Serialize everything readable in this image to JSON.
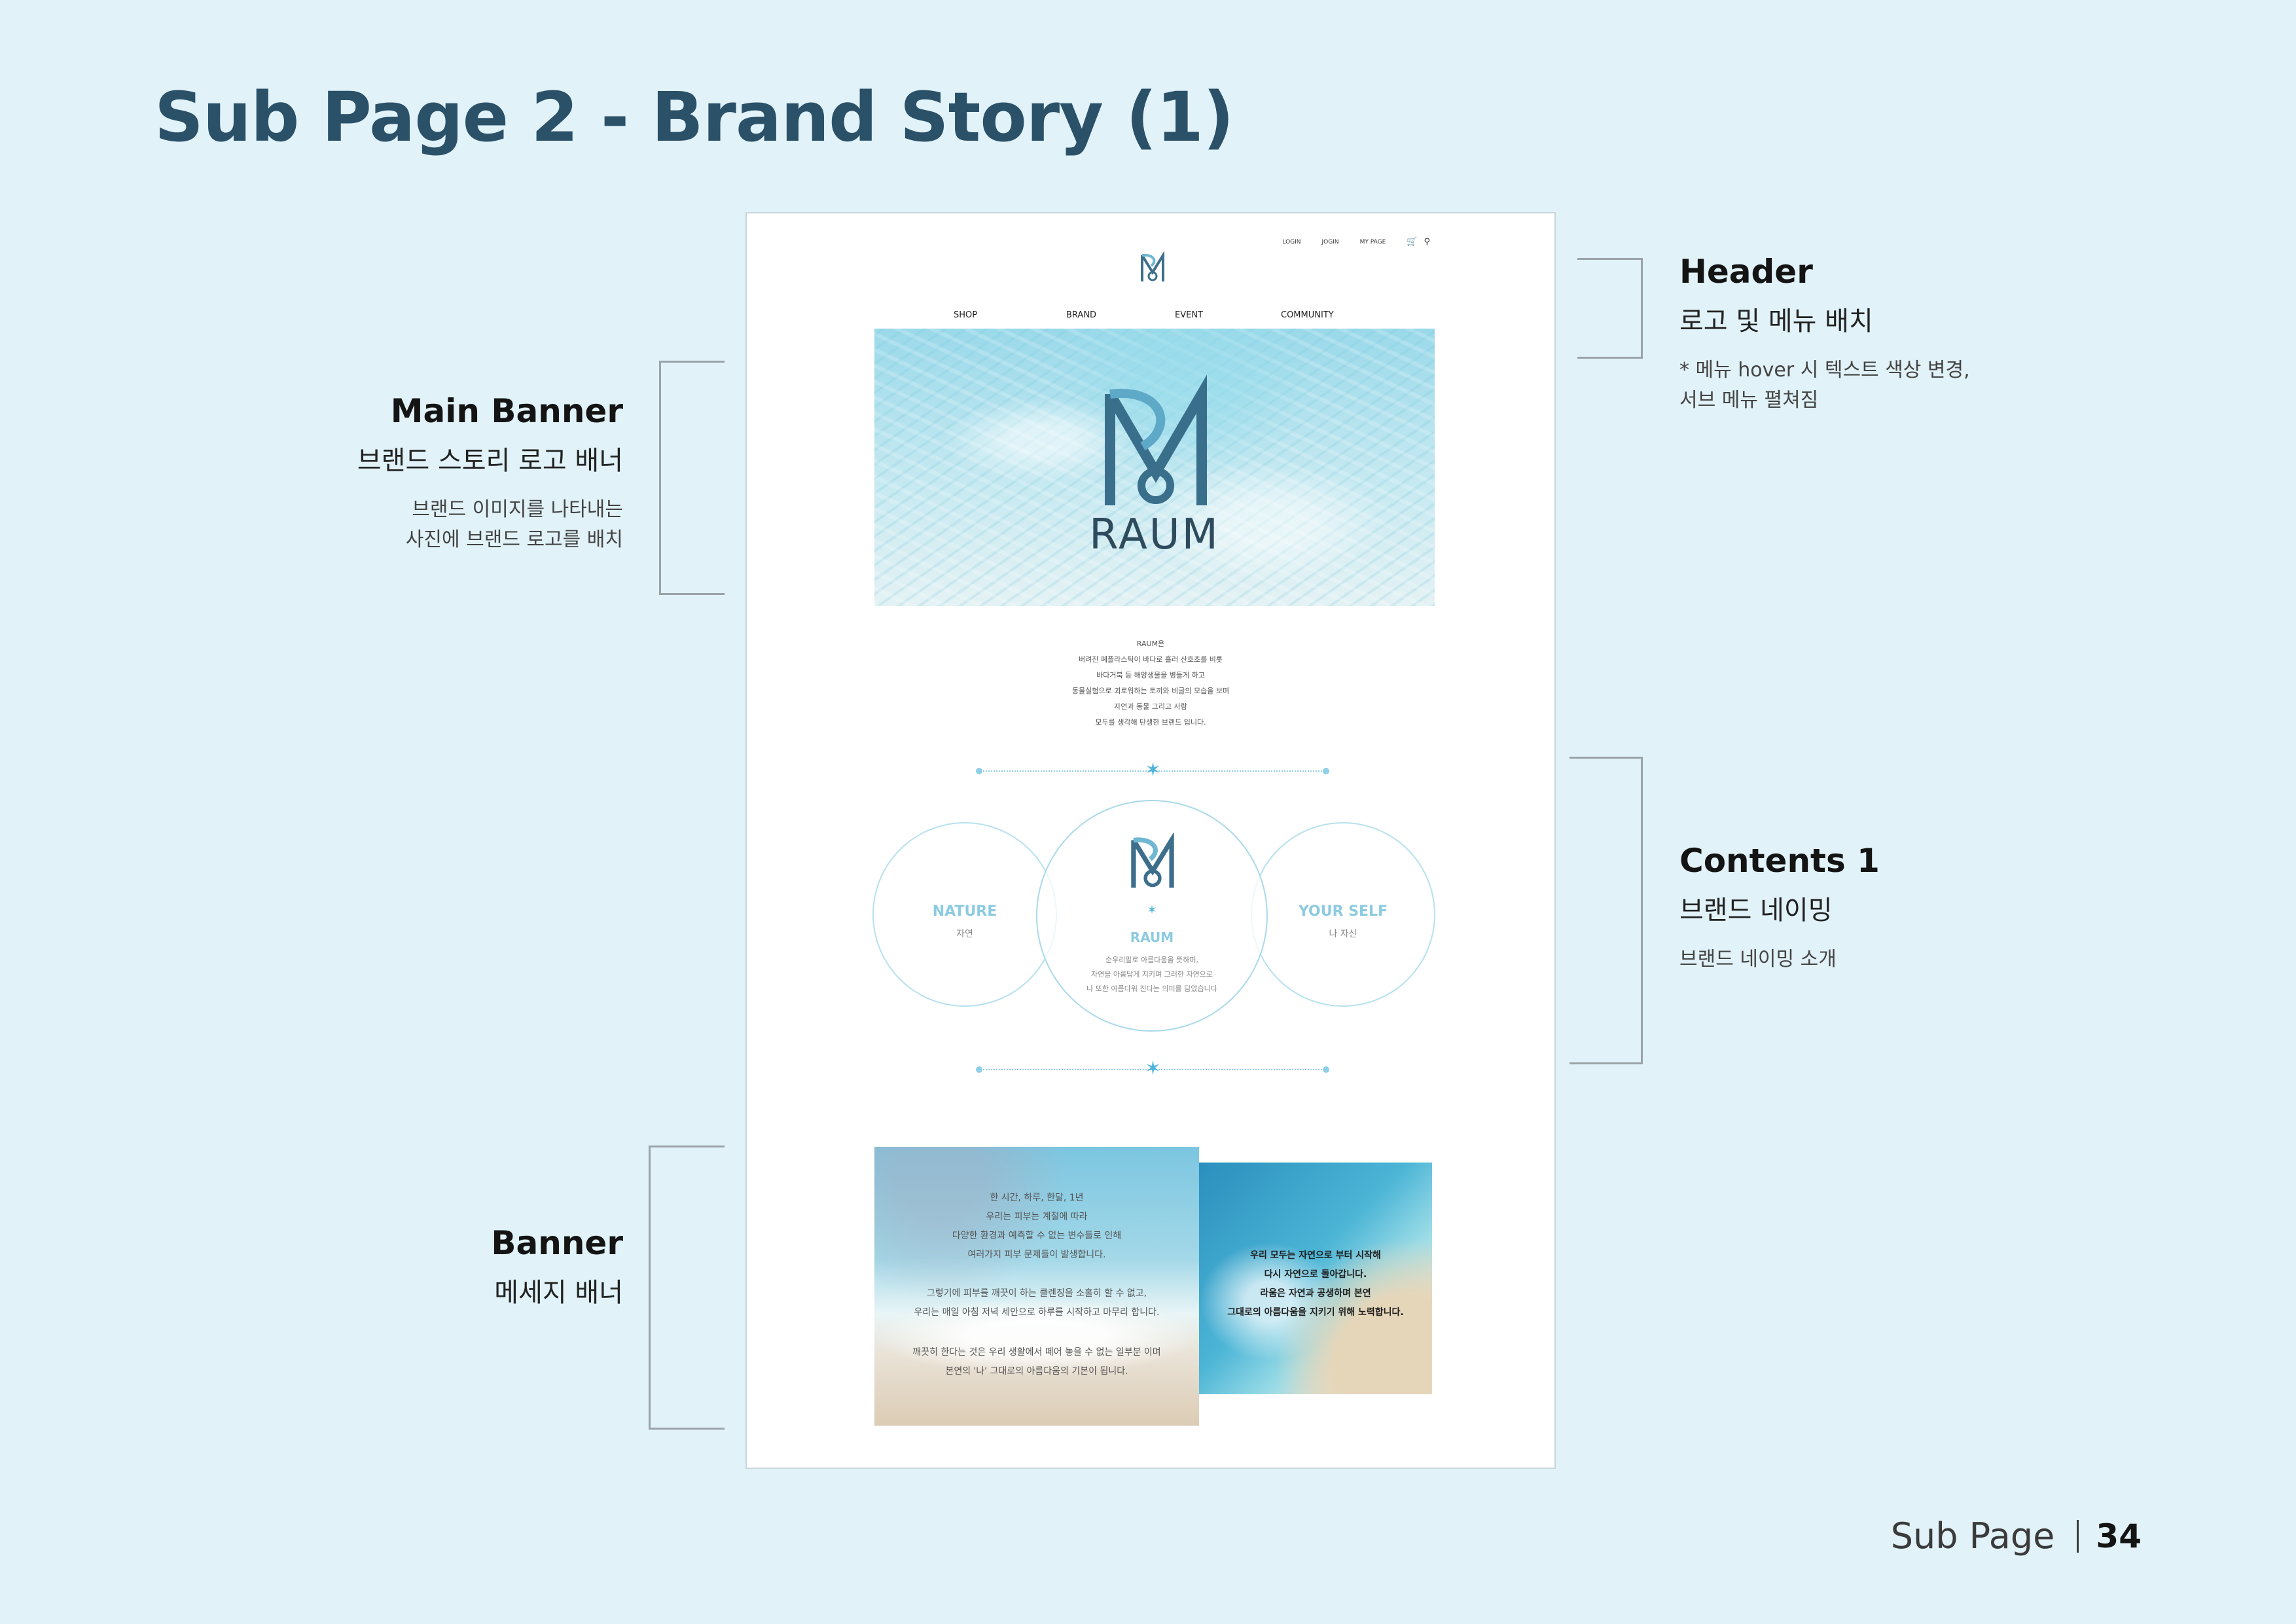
{
  "slide": {
    "title": "Sub Page 2 - Brand Story (1)"
  },
  "annotations": {
    "header": {
      "title": "Header",
      "subtitle": "로고 및 메뉴 배치",
      "desc": "* 메뉴 hover 시 텍스트 색상 변경,\n서브 메뉴 펼쳐짐"
    },
    "main_banner": {
      "title": "Main Banner",
      "subtitle": "브랜드 스토리 로고 배너",
      "desc": "브랜드 이미지를 나타내는\n사진에 브랜드 로고를 배치"
    },
    "contents1": {
      "title": "Contents 1",
      "subtitle": "브랜드 네이밍",
      "desc": "브랜드 네이밍 소개"
    },
    "banner": {
      "title": "Banner",
      "subtitle": "메세지 배너"
    }
  },
  "mockup": {
    "util_links": [
      "LOGIN",
      "JOGIN",
      "MY PAGE"
    ],
    "util_icons": [
      "cart-icon",
      "search-icon"
    ],
    "nav": [
      "SHOP",
      "BRAND",
      "EVENT",
      "COMMUNITY"
    ],
    "hero_wordmark": "RAUM",
    "intro_lines": [
      "RAUM은",
      "버려진 폐플라스틱이 바다로 흘러 산호초를 비롯",
      "바다거북 등 해양생물을 병들게 하고",
      "동물실험으로 괴로워하는 토끼와 비글의 모습을 보며",
      "자연과 동물 그리고 사람",
      "모두를 생각해 탄생한 브랜드 입니다."
    ],
    "naming": {
      "left_label": "NATURE",
      "left_sub": "자연",
      "center_label": "RAUM",
      "center_desc": [
        "순우리말로 아름다움을 뜻하며,",
        "자연을 아름답게 지키며 그러한 자연으로",
        "나 또한 아름다워 진다는 의미를 담았습니다"
      ],
      "right_label": "YOUR SELF",
      "right_sub": "나 자신"
    },
    "banner_left": {
      "block1": [
        "한 시간, 하루, 한달, 1년",
        "우리는 피부는 계절에 따라",
        "다양한 환경과 예측할 수 없는 변수들로 인해",
        "여러가지 피부 문제들이 발생합니다."
      ],
      "block2": [
        "그렇기에 피부를 깨끗이 하는 클렌징을 소홀히 할 수 없고,",
        "우리는 매일 아침 저녁 세안으로 하루를 시작하고 마무리 합니다."
      ],
      "block3": [
        "깨끗히 한다는 것은 우리 생활에서 떼어 놓을 수 없는 일부분 이며",
        "본연의 '나' 그대로의 아름다움의 기본이 됩니다."
      ]
    },
    "banner_right": [
      "우리 모두는 자연으로 부터 시작해",
      "다시 자연으로 돌아갑니다.",
      "라움은 자연과 공생하며 본연",
      "그대로의 아름다움을 지키기 위해 노력합니다."
    ]
  },
  "footer": {
    "section": "Sub Page",
    "page": "34"
  },
  "colors": {
    "background": "#e1f2f8",
    "title": "#2b5169",
    "accent": "#8ccbe0",
    "logo": "#4a8fb0"
  }
}
